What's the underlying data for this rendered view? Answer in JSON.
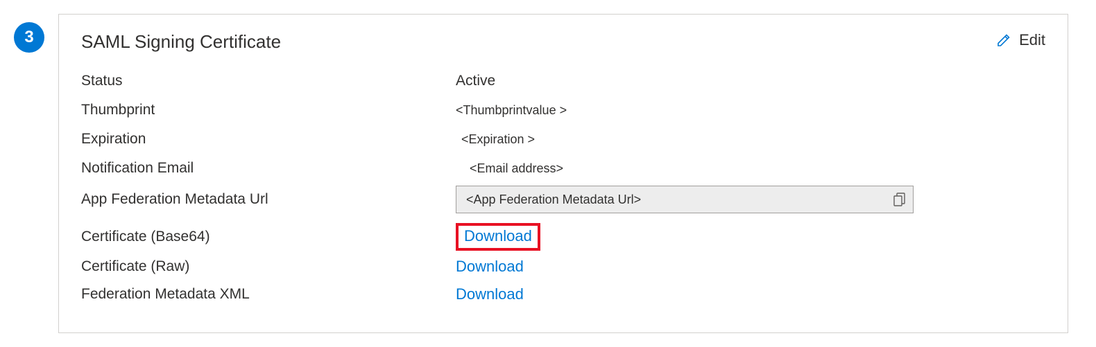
{
  "step": {
    "number": "3"
  },
  "card": {
    "title": "SAML Signing Certificate",
    "edit_label": "Edit"
  },
  "fields": {
    "status_label": "Status",
    "status_value": "Active",
    "thumbprint_label": "Thumbprint",
    "thumbprint_value": "<Thumbprintvalue >",
    "expiration_label": "Expiration",
    "expiration_value": "<Expiration >",
    "notification_label": "Notification Email",
    "notification_value": "<Email address>",
    "metadata_url_label": "App Federation Metadata Url",
    "metadata_url_value": "<App Federation  Metadata Url>",
    "cert_base64_label": "Certificate (Base64)",
    "cert_base64_link": "Download",
    "cert_raw_label": "Certificate (Raw)",
    "cert_raw_link": "Download",
    "fed_xml_label": "Federation Metadata XML",
    "fed_xml_link": "Download"
  }
}
